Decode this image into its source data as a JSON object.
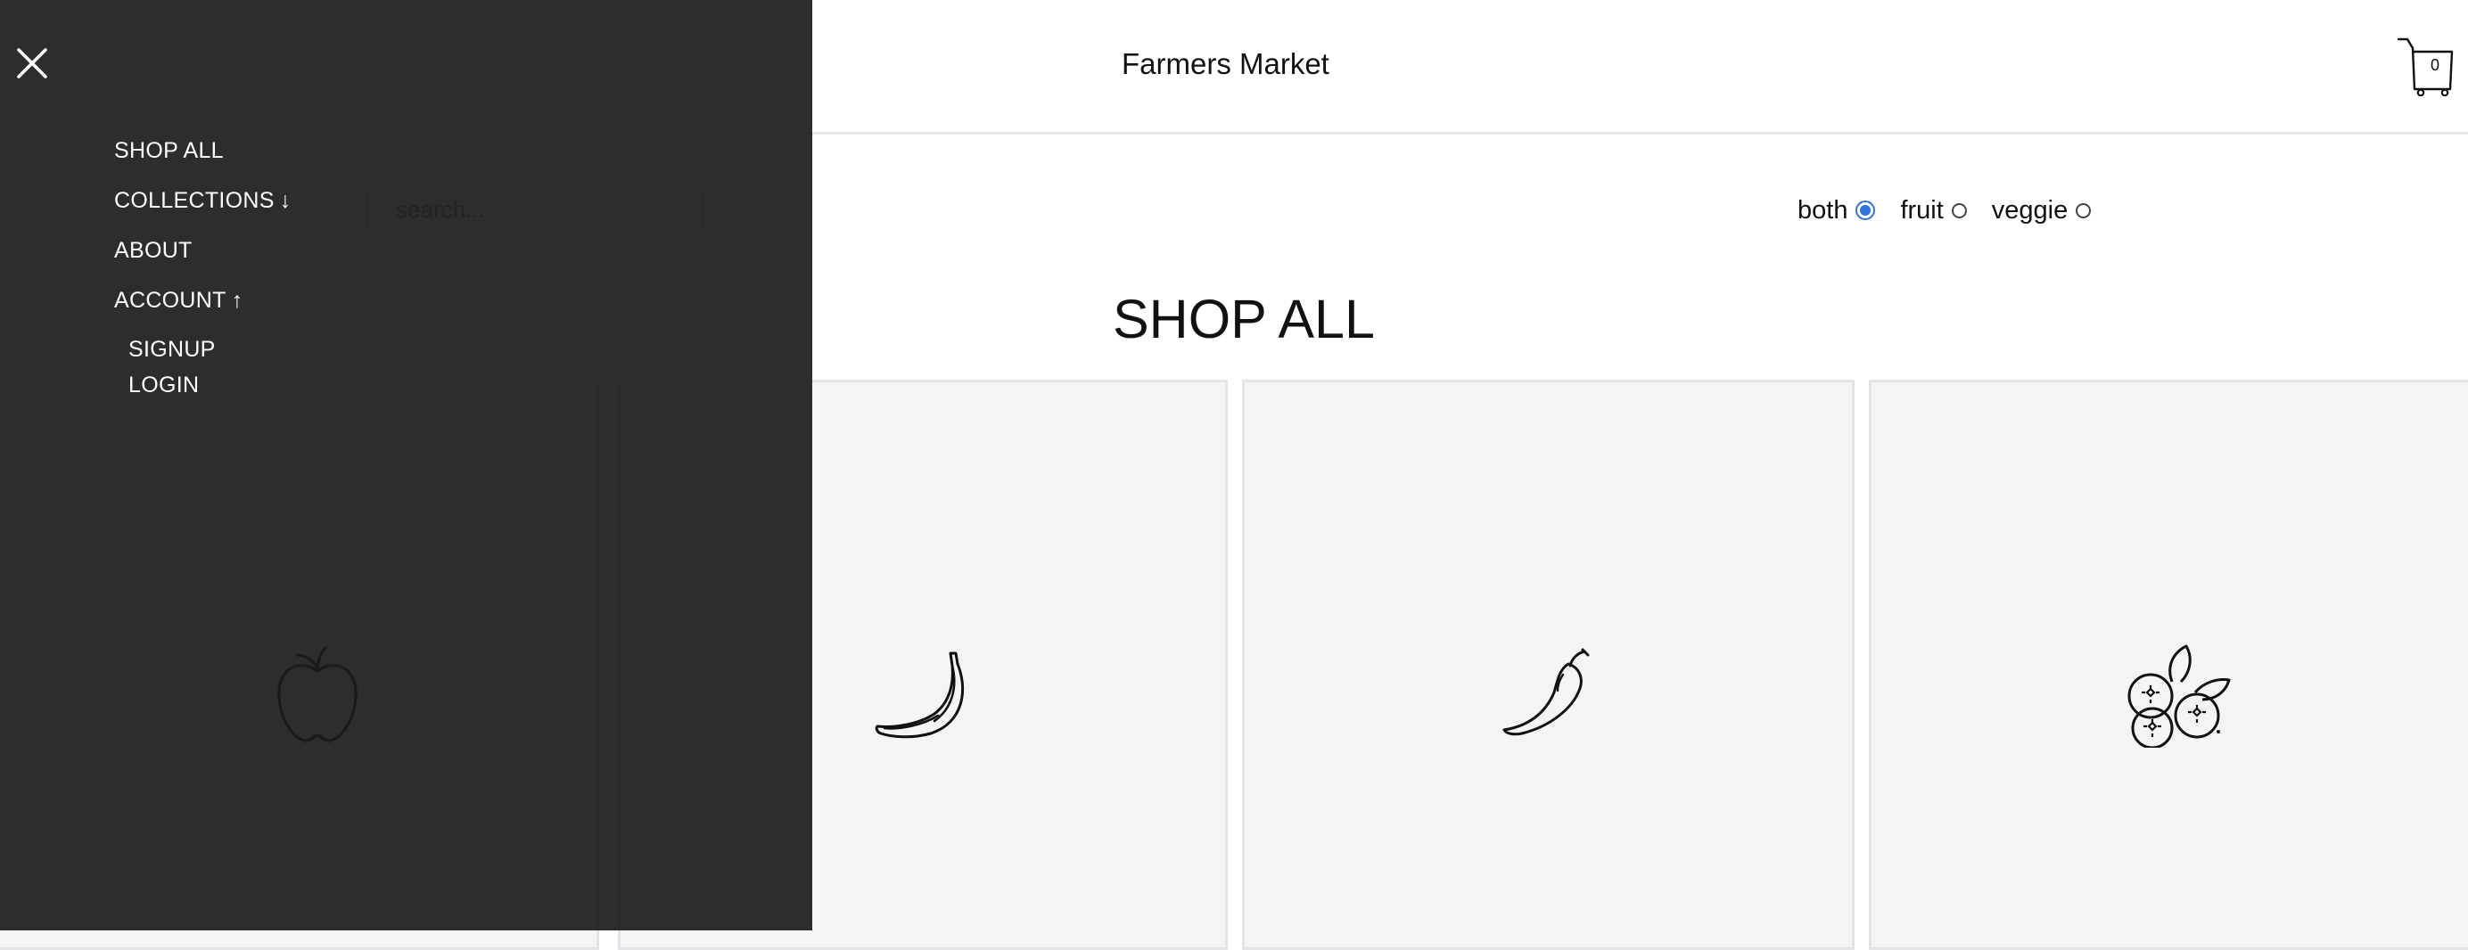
{
  "header": {
    "brand": "Farmers Market",
    "cart_count": "0",
    "cart_icon": "shopping-cart-icon"
  },
  "search": {
    "placeholder": "search..."
  },
  "filters": {
    "options": [
      {
        "label": "both",
        "checked": true
      },
      {
        "label": "fruit",
        "checked": false
      },
      {
        "label": "veggie",
        "checked": false
      }
    ],
    "accent_color": "#2f73e0"
  },
  "main": {
    "title": "SHOP ALL"
  },
  "products": [
    {
      "icon": "apple-icon"
    },
    {
      "icon": "unknown"
    },
    {
      "icon": "banana-icon"
    },
    {
      "icon": "chili-pepper-icon"
    },
    {
      "icon": "blueberries-icon"
    }
  ],
  "drawer": {
    "close_icon": "close-icon",
    "items": [
      {
        "label": "SHOP ALL",
        "arrow": ""
      },
      {
        "label": "COLLECTIONS",
        "arrow": "↓"
      },
      {
        "label": "ABOUT",
        "arrow": ""
      },
      {
        "label": "ACCOUNT",
        "arrow": "↑"
      }
    ],
    "account_items": [
      {
        "label": "SIGNUP"
      },
      {
        "label": "LOGIN"
      }
    ],
    "background_color": "#1b1b1b"
  }
}
